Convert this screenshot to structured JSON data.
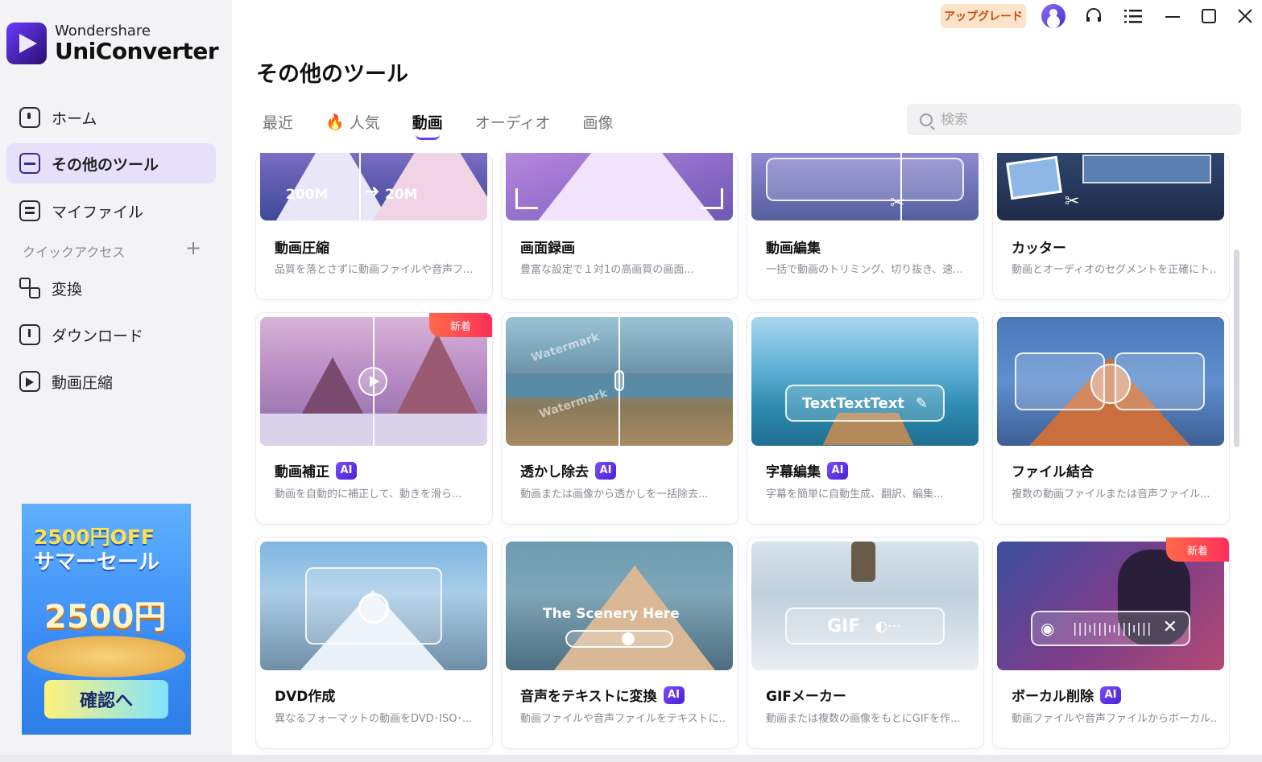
{
  "app": {
    "brand": "Wondershare",
    "product": "UniConverter"
  },
  "titlebar": {
    "upgrade_label": "アップグレード",
    "icons": [
      "avatar-icon",
      "headset-icon",
      "menu-list-icon",
      "minimize-icon",
      "maximize-icon",
      "close-icon"
    ]
  },
  "sidebar": {
    "items": [
      {
        "label": "ホーム",
        "icon": "home-icon"
      },
      {
        "label": "その他のツール",
        "icon": "toolbox-icon",
        "active": true
      },
      {
        "label": "マイファイル",
        "icon": "file-icon"
      }
    ],
    "quick_access_label": "クイックアクセス",
    "quick_items": [
      {
        "label": "変換",
        "icon": "convert-icon"
      },
      {
        "label": "ダウンロード",
        "icon": "download-icon"
      },
      {
        "label": "動画圧縮",
        "icon": "compress-icon"
      }
    ],
    "promo": {
      "line1": "2500円OFF",
      "line2": "サマーセール",
      "big": "2500円",
      "button": "確認へ"
    }
  },
  "main": {
    "title": "その他のツール",
    "tabs": [
      {
        "label": "最近"
      },
      {
        "label": "人気",
        "icon": "fire-icon"
      },
      {
        "label": "動画",
        "active": true
      },
      {
        "label": "オーディオ"
      },
      {
        "label": "画像"
      }
    ],
    "search_placeholder": "検索",
    "tools": [
      {
        "title": "動画圧縮",
        "desc": "品質を落とさずに動画ファイルや音声フ...",
        "ai": false,
        "new": false,
        "overlay_left": "200M",
        "overlay_right": "20M"
      },
      {
        "title": "画面録画",
        "desc": "豊富な設定で１対1の高画質の画面...",
        "ai": false,
        "new": false
      },
      {
        "title": "動画編集",
        "desc": "一括で動画のトリミング、切り抜き、速...",
        "ai": false,
        "new": false
      },
      {
        "title": "カッター",
        "desc": "動画とオーディオのセグメントを正確にト...",
        "ai": false,
        "new": false
      },
      {
        "title": "動画補正",
        "desc": "動画を自動的に補正して、動きを滑ら...",
        "ai": true,
        "new": true
      },
      {
        "title": "透かし除去",
        "desc": "動画または画像から透かしを一括除去...",
        "ai": true,
        "new": false,
        "watermark": "Watermark"
      },
      {
        "title": "字幕編集",
        "desc": "字幕を簡単に自動生成、翻訳、編集...",
        "ai": true,
        "new": false,
        "overlay": "TextTextText"
      },
      {
        "title": "ファイル結合",
        "desc": "複数の動画ファイルまたは音声ファイル...",
        "ai": false,
        "new": false
      },
      {
        "title": "DVD作成",
        "desc": "異なるフォーマットの動画をDVD･ISO･...",
        "ai": false,
        "new": false
      },
      {
        "title": "音声をテキストに変換",
        "desc": "動画ファイルや音声ファイルをテキストに...",
        "ai": true,
        "new": false,
        "overlay": "The Scenery Here"
      },
      {
        "title": "GIFメーカー",
        "desc": "動画または複数の画像をもとにGIFを作...",
        "ai": false,
        "new": false,
        "overlay": "GIF"
      },
      {
        "title": "ボーカル削除",
        "desc": "動画ファイルや音声ファイルからボーカル...",
        "ai": true,
        "new": true
      }
    ],
    "ai_label": "AI",
    "new_label": "新着"
  },
  "colors": {
    "accent": "#6b3bff",
    "sidebar_bg": "#f3f3f6",
    "active_bg": "#e6e0fb",
    "upgrade_bg": "#fde3c9",
    "new_badge": "#ff2e5a"
  }
}
